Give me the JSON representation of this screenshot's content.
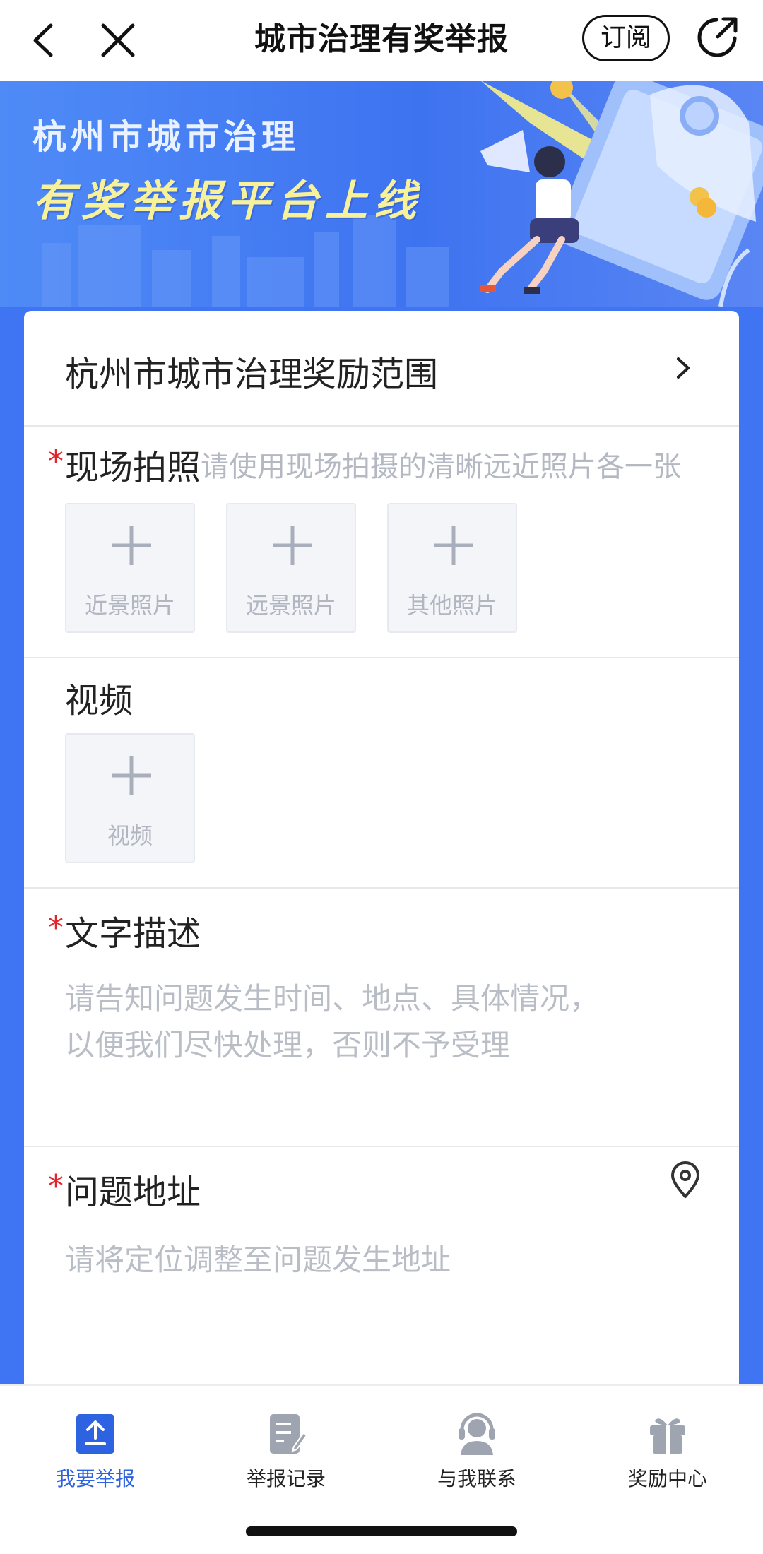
{
  "nav": {
    "title": "城市治理有奖举报",
    "subscribe_label": "订阅"
  },
  "banner": {
    "line1": "杭州市城市治理",
    "line2": "有奖举报平台上线"
  },
  "form": {
    "scope_label": "杭州市城市治理奖励范围",
    "photo": {
      "title": "现场拍照",
      "required": true,
      "hint": "请使用现场拍摄的清晰远近照片各一张",
      "slots": [
        {
          "label": "近景照片"
        },
        {
          "label": "远景照片"
        },
        {
          "label": "其他照片"
        }
      ]
    },
    "video": {
      "title": "视频",
      "required": false,
      "slot_label": "视频"
    },
    "description": {
      "title": "文字描述",
      "required": true,
      "placeholder_line1": "请告知问题发生时间、地点、具体情况，",
      "placeholder_line2": "以便我们尽快处理，否则不予受理"
    },
    "address": {
      "title": "问题地址",
      "required": true,
      "placeholder": "请将定位调整至问题发生地址"
    },
    "required_mark": "*"
  },
  "tabbar": {
    "active_index": 0,
    "active_color": "#2d62e0",
    "items": [
      {
        "label": "我要举报",
        "icon": "upload-icon"
      },
      {
        "label": "举报记录",
        "icon": "document-icon"
      },
      {
        "label": "与我联系",
        "icon": "headset-icon"
      },
      {
        "label": "奖励中心",
        "icon": "gift-icon"
      }
    ]
  },
  "colors": {
    "brand_blue": "#3f74f3",
    "required_red": "#e0262b",
    "hint_gray": "#b3b8c2",
    "banner_yellow": "#f7f19a"
  }
}
